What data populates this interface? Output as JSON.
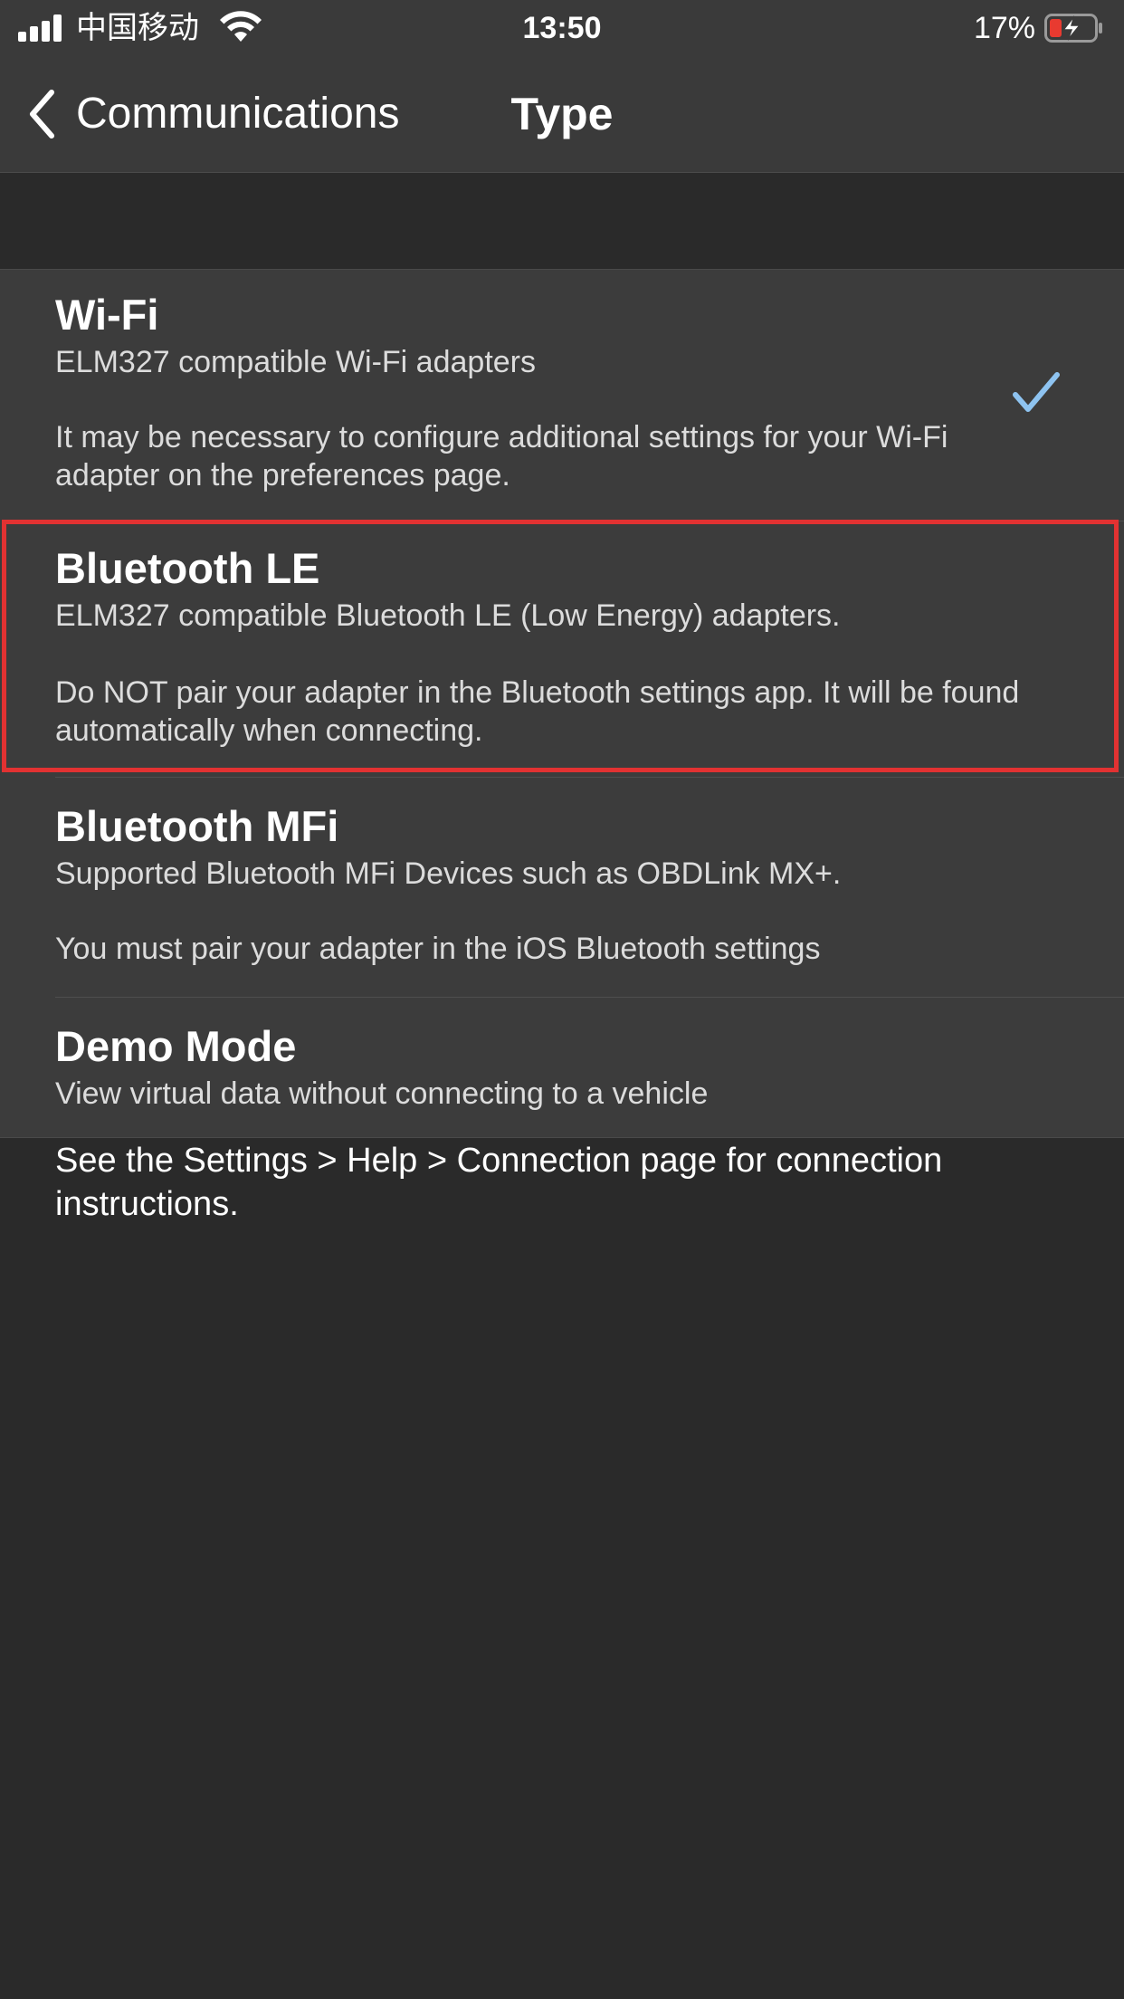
{
  "status_bar": {
    "carrier": "中国移动",
    "time": "13:50",
    "battery_percent": "17%",
    "battery_level": 0.17,
    "charging": true
  },
  "nav": {
    "back_label": "Communications",
    "title": "Type"
  },
  "options": [
    {
      "title": "Wi-Fi",
      "subtitle": "ELM327 compatible Wi-Fi adapters",
      "note": "It may be necessary to configure additional settings for your Wi-Fi adapter on the preferences page.",
      "selected": true
    },
    {
      "title": "Bluetooth LE",
      "subtitle": "ELM327 compatible Bluetooth LE (Low Energy) adapters.",
      "note": "Do NOT pair your adapter in the Bluetooth settings app. It will be found automatically when connecting.",
      "selected": false
    },
    {
      "title": "Bluetooth MFi",
      "subtitle": "Supported Bluetooth MFi Devices such as OBDLink MX+.",
      "note": "You must pair your adapter in the iOS Bluetooth settings",
      "selected": false
    },
    {
      "title": "Demo Mode",
      "subtitle": "View virtual data without connecting to a vehicle",
      "selected": false
    }
  ],
  "footer": {
    "text": "See the Settings > Help > Connection page for connection instructions."
  },
  "colors": {
    "background": "#2a2a2a",
    "cell": "#3c3c3c",
    "bar": "#3a3a3a",
    "checkmark": "#8ec3f0",
    "highlight": "#e23232",
    "battery_low": "#e83a30"
  },
  "icons": {
    "signal": "cellular-signal-icon",
    "wifi": "wifi-icon",
    "battery": "battery-charging-icon",
    "back": "chevron-left-icon",
    "check": "checkmark-icon"
  }
}
